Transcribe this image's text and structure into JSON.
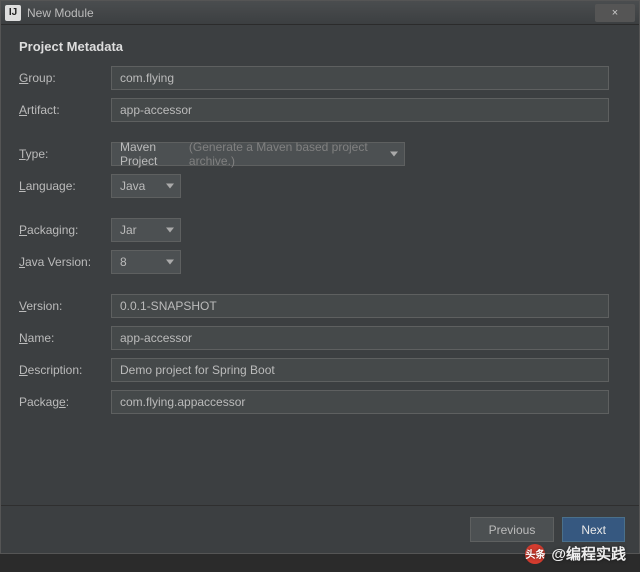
{
  "window": {
    "icon_glyph": "IJ",
    "title": "New Module",
    "close_glyph": "×"
  },
  "section": {
    "title": "Project Metadata"
  },
  "labels": {
    "group": "Group:",
    "artifact": "Artifact:",
    "type": "Type:",
    "language": "Language:",
    "packaging": "Packaging:",
    "java_version": "Java Version:",
    "version": "Version:",
    "name": "Name:",
    "description": "Description:",
    "package": "Package:"
  },
  "mnemonics": {
    "group": "G",
    "artifact": "A",
    "type": "T",
    "language": "L",
    "packaging": "P",
    "java_version": "J",
    "version": "V",
    "name": "N",
    "description": "D",
    "package_last": "e"
  },
  "fields": {
    "group": "com.flying",
    "artifact": "app-accessor",
    "type_main": "Maven Project",
    "type_hint": "(Generate a Maven based project archive.)",
    "language": "Java",
    "packaging": "Jar",
    "java_version": "8",
    "version": "0.0.1-SNAPSHOT",
    "name": "app-accessor",
    "description": "Demo project for Spring Boot",
    "package": "com.flying.appaccessor"
  },
  "buttons": {
    "previous": "Previous",
    "next": "Next"
  },
  "watermark": {
    "logo": "头条",
    "text": "@编程实践"
  }
}
